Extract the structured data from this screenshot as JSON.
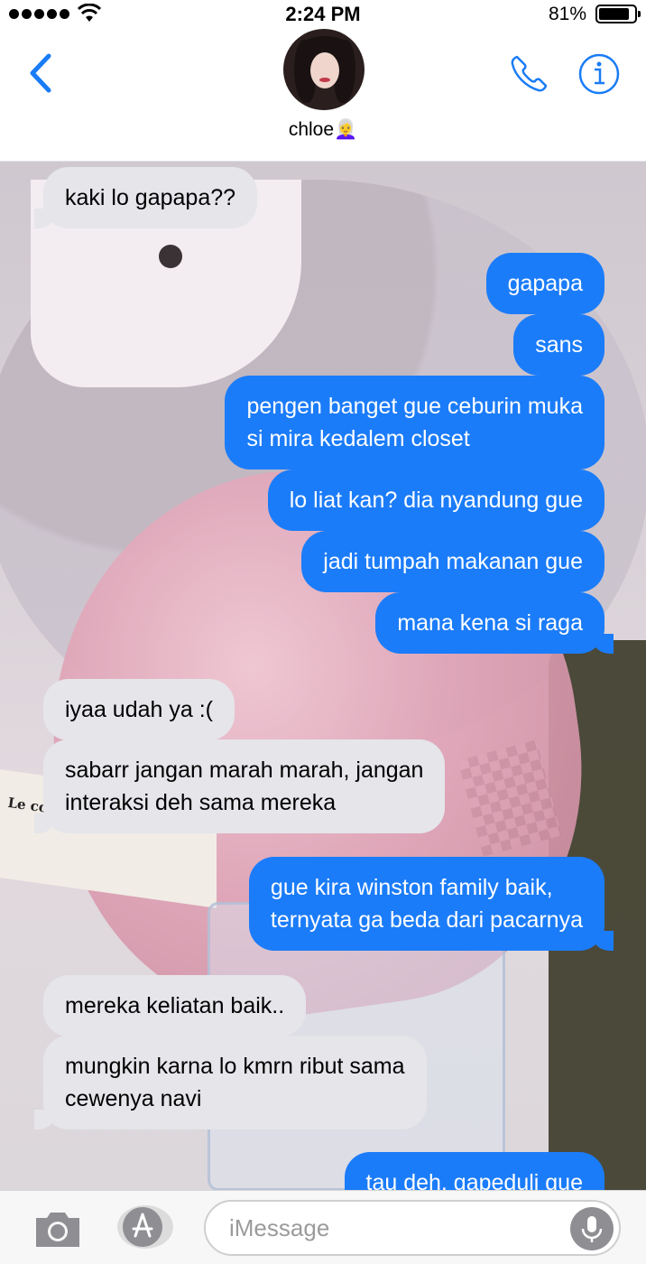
{
  "status_bar": {
    "time": "2:24 PM",
    "battery_percent": "81%"
  },
  "header": {
    "contact_name": "chloe👩‍🦳",
    "back_icon": "chevron-left-icon",
    "call_icon": "phone-icon",
    "info_icon": "info-icon"
  },
  "messages": [
    {
      "direction": "received",
      "text": "kaki lo gapapa??"
    },
    {
      "direction": "sent",
      "text": "gapapa"
    },
    {
      "direction": "sent",
      "text": "sans"
    },
    {
      "direction": "sent",
      "text": "pengen banget gue ceburin muka\nsi mira kedalem closet"
    },
    {
      "direction": "sent",
      "text": "lo liat kan? dia nyandung gue"
    },
    {
      "direction": "sent",
      "text": "jadi tumpah makanan gue"
    },
    {
      "direction": "sent",
      "text": "mana kena si raga"
    },
    {
      "direction": "received",
      "text": "iyaa udah ya :("
    },
    {
      "direction": "received",
      "text": "sabarr jangan marah marah, jangan\ninteraksi deh sama mereka"
    },
    {
      "direction": "sent",
      "text": "gue kira winston family baik,\nternyata ga beda dari pacarnya"
    },
    {
      "direction": "received",
      "text": "mereka keliatan baik.."
    },
    {
      "direction": "received",
      "text": "mungkin karna lo kmrn ribut sama\ncewenya navi"
    },
    {
      "direction": "sent",
      "text": "tau deh, gapeduli gue"
    }
  ],
  "wallpaper": {
    "book_text": "Le comte de Monte"
  },
  "input_bar": {
    "placeholder": "iMessage",
    "value": "",
    "camera_icon": "camera-icon",
    "apps_icon": "app-store-icon",
    "mic_icon": "microphone-icon"
  },
  "colors": {
    "sent_bubble": "#1b7cf9",
    "received_bubble": "#e5e5ea",
    "accent": "#1a7cf6"
  }
}
